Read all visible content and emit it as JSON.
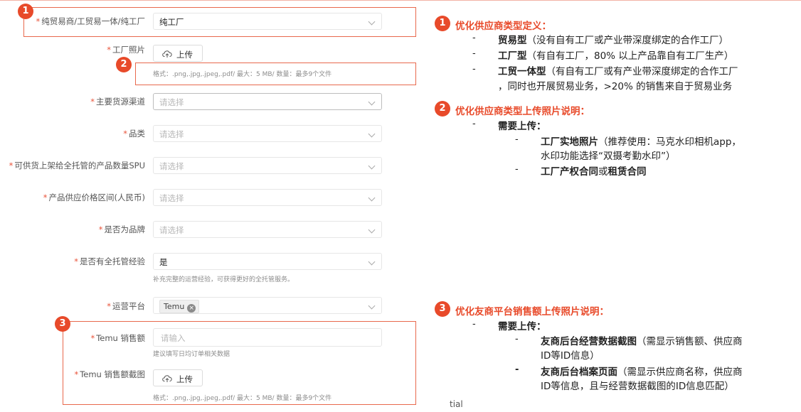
{
  "form": {
    "f1": {
      "label": "纯贸易商/工贸易一体/纯工厂",
      "value": "纯工厂"
    },
    "f2": {
      "label": "工厂照片",
      "upload": "上传",
      "hint": "格式：.png,.jpg,.jpeg,.pdf/ 最大：5 MB/ 数量：最多9个文件"
    },
    "f3": {
      "label": "主要货源渠道",
      "placeholder": "请选择"
    },
    "f4": {
      "label": "品类",
      "placeholder": "请选择"
    },
    "f5": {
      "label": "可供货上架给全托管的产品数量SPU",
      "placeholder": "请选择"
    },
    "f6": {
      "label": "产品供应价格区间(人民币)",
      "placeholder": "请选择"
    },
    "f7": {
      "label": "是否为品牌",
      "placeholder": "请选择"
    },
    "f8": {
      "label": "是否有全托管经验",
      "value": "是",
      "hint": "补充完整的运营经验，可获得更好的全托管服务。"
    },
    "f9": {
      "label": "运营平台",
      "tag": "Temu",
      "tag_close": "×"
    },
    "f10": {
      "label": "Temu 销售额",
      "placeholder": "请输入",
      "hint": "建议填写日均订单相关数据"
    },
    "f11": {
      "label": "Temu 销售额截图",
      "upload": "上传",
      "hint": "格式：.png,.jpg,.jpeg,.pdf/ 最大：5 MB/ 数量：最多9个文件"
    },
    "required_mark": "*"
  },
  "badges": [
    "1",
    "2",
    "3"
  ],
  "notes": {
    "s1": {
      "title": "优化供应商类型定义：",
      "items": [
        {
          "bold": "贸易型",
          "text": "（没有自有工厂或产业带深度绑定的合作工厂）"
        },
        {
          "bold": "工厂型",
          "text": "（有自有工厂，80% 以上产品靠自有工厂生产）"
        },
        {
          "bold": "工贸一体型",
          "text": "（有自有工厂或有产业带深度绑定的合作工厂",
          "cont": "，同时也开展贸易业务，>20% 的销售来自于贸易业务"
        }
      ]
    },
    "s2": {
      "title": "优化供应商类型上传照片说明：",
      "need": "需要上传：",
      "sub1_bold": "工厂实地照片",
      "sub1_text": "（推荐使用：马克水印相机app，",
      "sub1_cont": "水印功能选择“双摄考勤水印”）",
      "sub2_bold1": "工厂产权合同",
      "sub2_or": "或",
      "sub2_bold2": "租赁合同"
    },
    "s3": {
      "title": "优化友商平台销售额上传照片说明：",
      "need": "需要上传：",
      "sub1_bold": "友商后台经营数据截图",
      "sub1_text": "（需显示销售额、供应商",
      "sub1_cont": "ID等ID信息）",
      "sub2_bold": "友商后台档案页面",
      "sub2_text": "（需显示供应商名称，供应商",
      "sub2_cont": "ID等信息，且与经营数据截图的ID信息匹配）"
    },
    "dash": "-"
  },
  "footer": "tial"
}
